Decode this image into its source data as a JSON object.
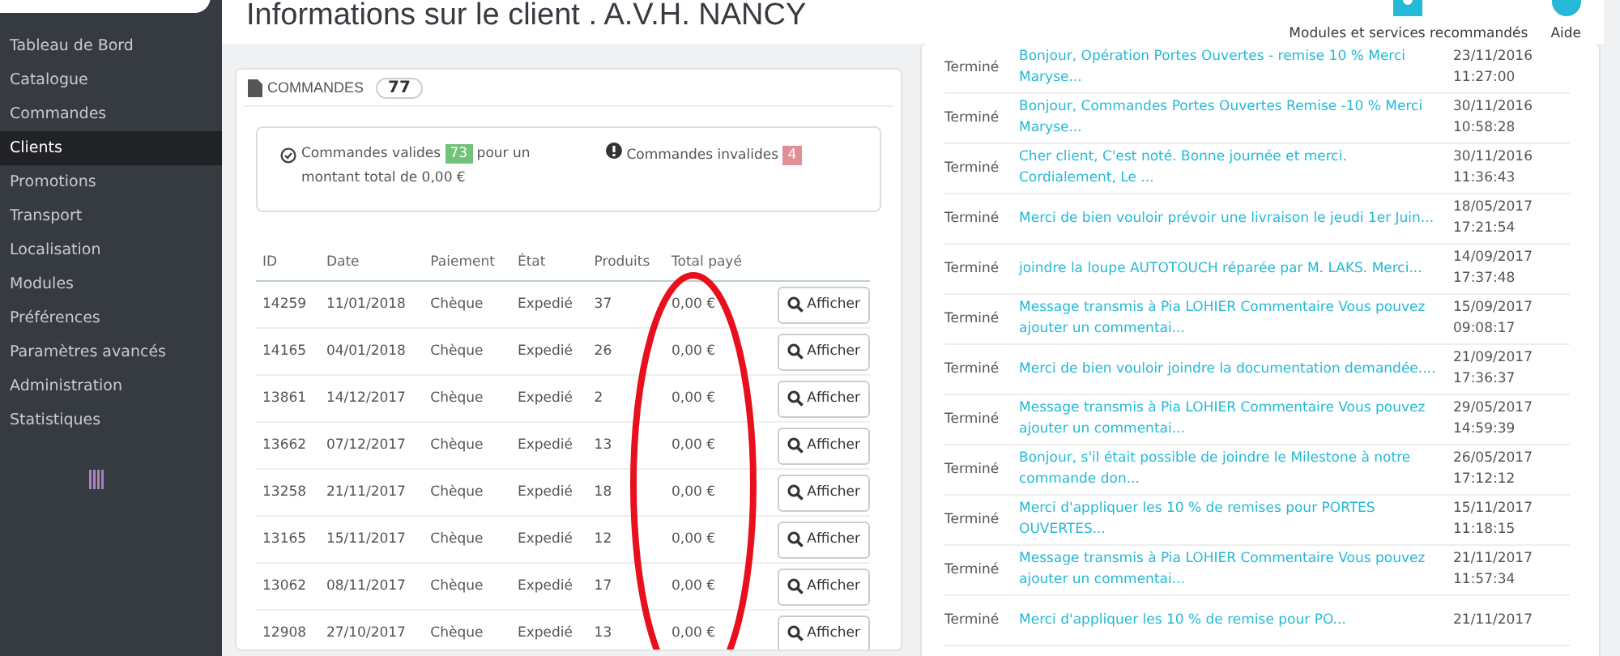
{
  "sidebar": {
    "items": [
      {
        "label": "Tableau de Bord",
        "selected": false
      },
      {
        "label": "Catalogue",
        "selected": false
      },
      {
        "label": "Commandes",
        "selected": false
      },
      {
        "label": "Clients",
        "selected": true
      },
      {
        "label": "Promotions",
        "selected": false
      },
      {
        "label": "Transport",
        "selected": false
      },
      {
        "label": "Localisation",
        "selected": false
      },
      {
        "label": "Modules",
        "selected": false
      },
      {
        "label": "Préférences",
        "selected": false
      },
      {
        "label": "Paramètres avancés",
        "selected": false
      },
      {
        "label": "Administration",
        "selected": false
      },
      {
        "label": "Statistiques",
        "selected": false
      }
    ]
  },
  "header": {
    "title": "Informations sur le client . A.V.H. NANCY",
    "toolbar": [
      {
        "label": "Modules et services recommandés",
        "kind": "modules"
      },
      {
        "label": "Aide",
        "kind": "help"
      }
    ]
  },
  "orders_panel": {
    "title": "COMMANDES",
    "count": "77",
    "valid": {
      "label": "Commandes valides",
      "count": "73",
      "suffix": "pour un montant total de 0,00 €"
    },
    "invalid": {
      "label": "Commandes invalides",
      "count": "4"
    },
    "columns": [
      "ID",
      "Date",
      "Paiement",
      "État",
      "Produits",
      "Total payé"
    ],
    "rows": [
      {
        "id": "14259",
        "date": "11/01/2018",
        "payment": "Chèque",
        "state": "Expedié",
        "products": "37",
        "total": "0,00 €",
        "action": "Afficher"
      },
      {
        "id": "14165",
        "date": "04/01/2018",
        "payment": "Chèque",
        "state": "Expedié",
        "products": "26",
        "total": "0,00 €",
        "action": "Afficher"
      },
      {
        "id": "13861",
        "date": "14/12/2017",
        "payment": "Chèque",
        "state": "Expedié",
        "products": "2",
        "total": "0,00 €",
        "action": "Afficher"
      },
      {
        "id": "13662",
        "date": "07/12/2017",
        "payment": "Chèque",
        "state": "Expedié",
        "products": "13",
        "total": "0,00 €",
        "action": "Afficher"
      },
      {
        "id": "13258",
        "date": "21/11/2017",
        "payment": "Chèque",
        "state": "Expedié",
        "products": "18",
        "total": "0,00 €",
        "action": "Afficher"
      },
      {
        "id": "13165",
        "date": "15/11/2017",
        "payment": "Chèque",
        "state": "Expedié",
        "products": "12",
        "total": "0,00 €",
        "action": "Afficher"
      },
      {
        "id": "13062",
        "date": "08/11/2017",
        "payment": "Chèque",
        "state": "Expedié",
        "products": "17",
        "total": "0,00 €",
        "action": "Afficher"
      },
      {
        "id": "12908",
        "date": "27/10/2017",
        "payment": "Chèque",
        "state": "Expedié",
        "products": "13",
        "total": "0,00 €",
        "action": "Afficher"
      }
    ]
  },
  "messages": {
    "rows": [
      {
        "status": "Terminé",
        "message": "Bonjour, Opération Portes Ouvertes - remise 10 % Merci Maryse...",
        "date": "23/11/2016",
        "time": "11:27:00"
      },
      {
        "status": "Terminé",
        "message": "Bonjour, Commandes Portes Ouvertes Remise -10 % Merci Maryse...",
        "date": "30/11/2016",
        "time": "10:58:28"
      },
      {
        "status": "Terminé",
        "message": "Cher client, C'est noté. Bonne journée et merci. Cordialement, Le ...",
        "date": "30/11/2016",
        "time": "11:36:43"
      },
      {
        "status": "Terminé",
        "message": "Merci de bien vouloir prévoir une livraison le jeudi 1er Juin...",
        "date": "18/05/2017",
        "time": "17:21:54"
      },
      {
        "status": "Terminé",
        "message": "joindre la loupe AUTOTOUCH réparée par M. LAKS. Merci...",
        "date": "14/09/2017",
        "time": "17:37:48"
      },
      {
        "status": "Terminé",
        "message": "Message transmis à Pia LOHIER Commentaire Vous pouvez ajouter un commentai...",
        "date": "15/09/2017",
        "time": "09:08:17"
      },
      {
        "status": "Terminé",
        "message": "Merci de bien vouloir joindre la documentation demandée....",
        "date": "21/09/2017",
        "time": "17:36:37"
      },
      {
        "status": "Terminé",
        "message": "Message transmis à Pia LOHIER Commentaire Vous pouvez ajouter un commentai...",
        "date": "29/05/2017",
        "time": "14:59:39"
      },
      {
        "status": "Terminé",
        "message": "Bonjour, s'il était possible de joindre le Milestone à notre commande don...",
        "date": "26/05/2017",
        "time": "17:12:12"
      },
      {
        "status": "Terminé",
        "message": "Merci d'appliquer les 10 % de remises pour PORTES OUVERTES...",
        "date": "15/11/2017",
        "time": "11:18:15"
      },
      {
        "status": "Terminé",
        "message": "Message transmis à Pia LOHIER Commentaire Vous pouvez ajouter un commentai...",
        "date": "21/11/2017",
        "time": "11:57:34"
      },
      {
        "status": "Terminé",
        "message": "Merci d'appliquer les 10 % de remise pour PO...",
        "date": "21/11/2017"
      }
    ]
  }
}
